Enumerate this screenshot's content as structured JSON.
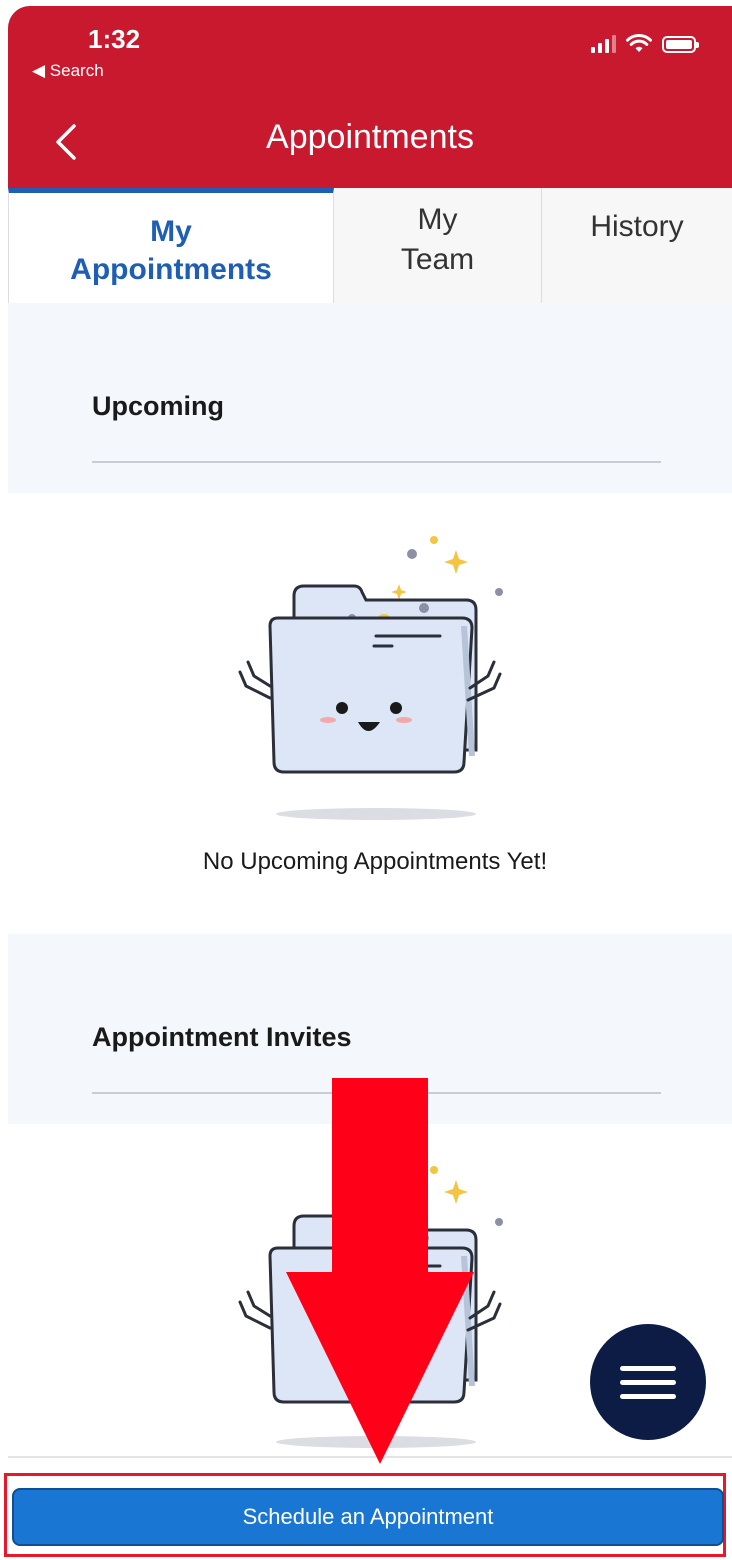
{
  "status_bar": {
    "time": "1:32",
    "back_to": "◀ Search"
  },
  "header": {
    "title": "Appointments",
    "back_icon": "chevron-left-icon"
  },
  "tabs": [
    {
      "line1": "My",
      "line2": "Appointments",
      "active": true
    },
    {
      "line1": "My",
      "line2": "Team",
      "active": false
    },
    {
      "line1": "History",
      "line2": "",
      "active": false
    }
  ],
  "sections": {
    "upcoming": {
      "title": "Upcoming",
      "empty_message": "No Upcoming Appointments Yet!"
    },
    "invites": {
      "title": "Appointment Invites"
    }
  },
  "fab": {
    "icon": "hamburger-menu-icon"
  },
  "cta": {
    "label": "Schedule an Appointment"
  },
  "colors": {
    "brand_red": "#c8192e",
    "active_tab_blue": "#1f5fb3",
    "button_blue": "#1976d2",
    "fab_navy": "#0d1c45",
    "annotation_red": "#e8182a"
  }
}
